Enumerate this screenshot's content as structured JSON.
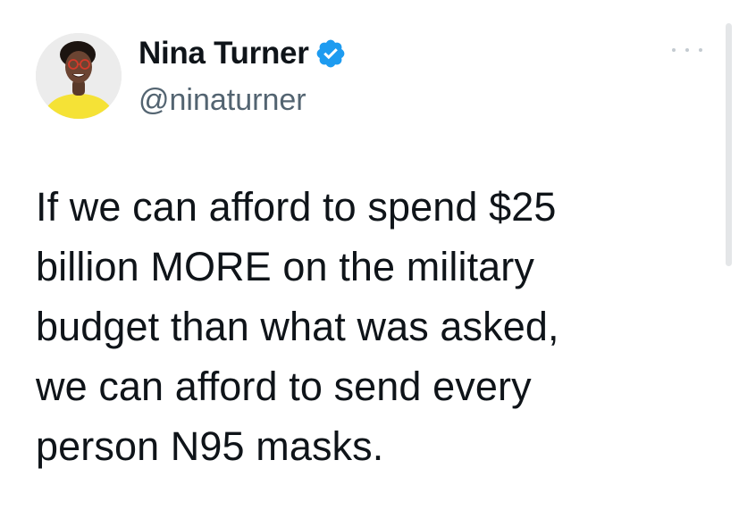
{
  "author": {
    "display_name": "Nina Turner",
    "handle": "@ninaturner",
    "verified": true,
    "verified_icon": "verified-badge-icon",
    "verified_color": "#1d9bf0"
  },
  "more_icon": "more-options-icon",
  "tweet": {
    "text": "If we can afford to spend $25\nbillion MORE on the military\nbudget than what was asked,\nwe can afford to send every\nperson N95 masks."
  },
  "colors": {
    "text": "#0f1419",
    "secondary_text": "#536471",
    "background": "#ffffff",
    "avatar_shirt": "#f5e236"
  }
}
